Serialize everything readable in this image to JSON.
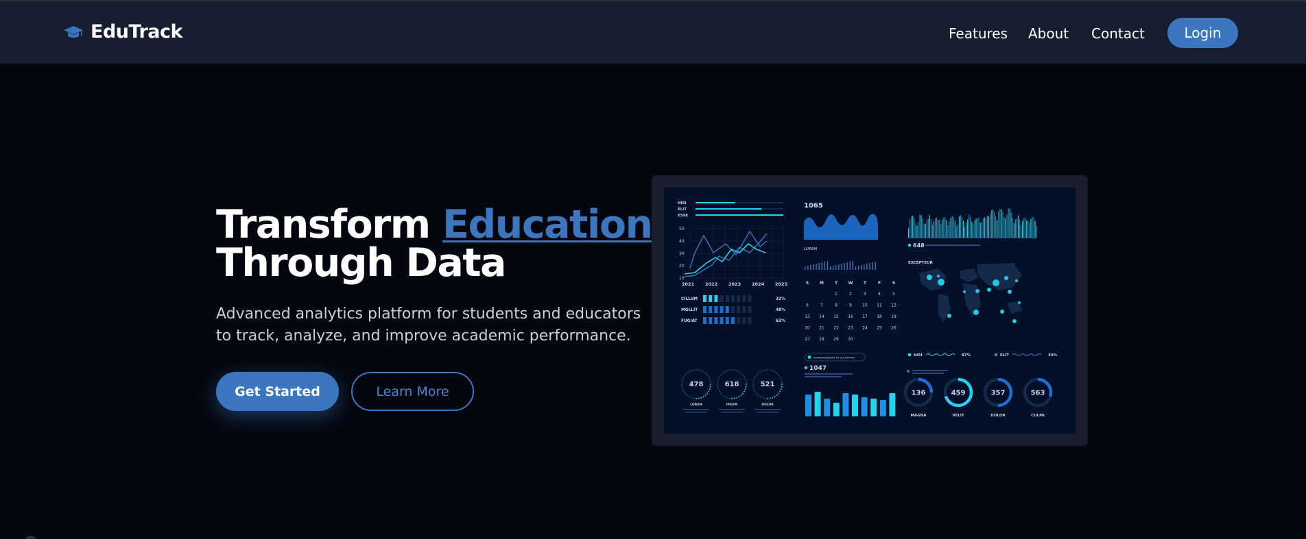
{
  "nav": {
    "brand": "EduTrack",
    "brand_icon": "graduation-cap-icon",
    "links": [
      "Features",
      "About",
      "Contact"
    ],
    "login_label": "Login"
  },
  "hero": {
    "title_part1": "Transform ",
    "title_highlight": "Education",
    "title_line2": "Through Data",
    "subtitle": "Advanced analytics platform for students and educators to track, analyze, and improve academic performance.",
    "primary_cta": "Get Started",
    "secondary_cta": "Learn More"
  },
  "dashboard": {
    "top_bars": [
      {
        "label": "NISI",
        "value": 0.45
      },
      {
        "label": "ELIT",
        "value": 0.75
      },
      {
        "label": "ESSE",
        "value": 1.0
      }
    ],
    "line_chart": {
      "y_ticks": [
        "50",
        "40",
        "30",
        "20",
        "10"
      ],
      "x_ticks": [
        "2021",
        "2022",
        "2023",
        "2024",
        "2025"
      ]
    },
    "progress_rows": [
      {
        "label": "CILLUM",
        "percent": "32%",
        "filled": 3
      },
      {
        "label": "MOLLIT",
        "percent": "48%",
        "filled": 5
      },
      {
        "label": "FUGIAT",
        "percent": "63%",
        "filled": 6
      }
    ],
    "small_rings": [
      {
        "value": "478",
        "label": "LOREM"
      },
      {
        "value": "618",
        "label": "IPSUM"
      },
      {
        "value": "521",
        "label": "DOLOR"
      }
    ],
    "wave_value": "1065",
    "wave_label": "LOREM",
    "calendar": {
      "days": [
        "S",
        "M",
        "T",
        "W",
        "T",
        "F",
        "S"
      ],
      "dates": [
        "",
        "",
        "1",
        "2",
        "3",
        "4",
        "5",
        "6",
        "7",
        "8",
        "9",
        "10",
        "11",
        "12",
        "13",
        "14",
        "15",
        "16",
        "17",
        "18",
        "19",
        "20",
        "21",
        "22",
        "23",
        "24",
        "25",
        "26",
        "27",
        "28",
        "29",
        "30"
      ]
    },
    "calendar_pill": "REPREHENDERIT IN VOLUPTATE",
    "bars_value": "1047",
    "spectrum_value": "648",
    "map_label": "EXCEPTEUR",
    "legend_items": [
      {
        "label": "NISI",
        "percent": "87%"
      },
      {
        "label": "ELIT",
        "percent": "34%"
      }
    ],
    "big_rings": [
      {
        "value": "136",
        "label": "MAGNA",
        "fraction": 0.25
      },
      {
        "value": "459",
        "label": "VELIT",
        "fraction": 0.7
      },
      {
        "value": "357",
        "label": "DOLOR",
        "fraction": 0.5
      },
      {
        "value": "563",
        "label": "CULPA",
        "fraction": 0.3
      }
    ],
    "colors": {
      "accent": "#3b76bf",
      "cyan": "#22d3ee",
      "panel": "#041027"
    }
  }
}
